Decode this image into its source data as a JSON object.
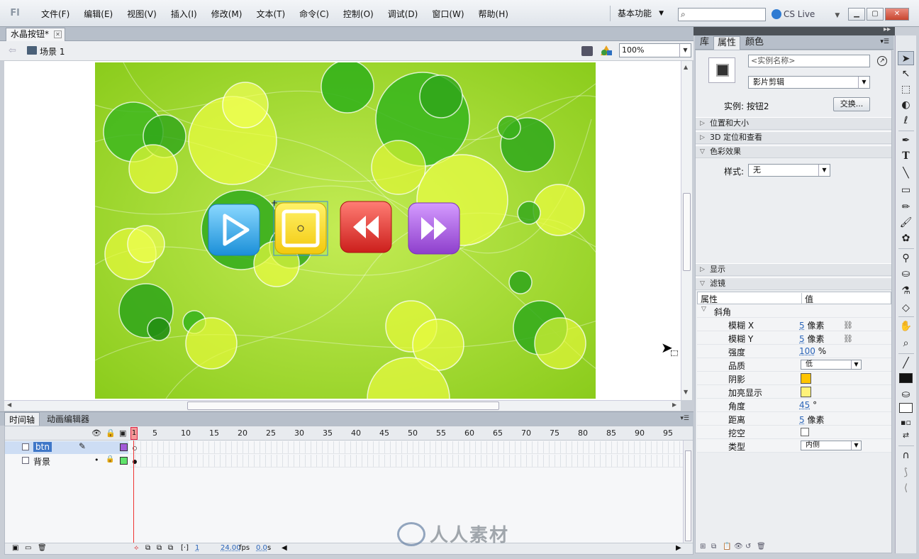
{
  "menu": {
    "app_logo": "Fl",
    "items": [
      "文件(F)",
      "编辑(E)",
      "视图(V)",
      "插入(I)",
      "修改(M)",
      "文本(T)",
      "命令(C)",
      "控制(O)",
      "调试(D)",
      "窗口(W)",
      "帮助(H)"
    ],
    "workspace": "基本功能",
    "search_icon": "search-icon",
    "cs_live": "CS Live"
  },
  "document": {
    "tab_title": "水晶按钮*",
    "scene": "场景 1",
    "zoom": "100%"
  },
  "stage": {
    "background_color": "#9ed22c",
    "buttons": [
      {
        "name": "play-button",
        "color": "#3aa9e8",
        "icon": "play-icon"
      },
      {
        "name": "stop-button",
        "color": "#f7dc1f",
        "icon": "stop-icon"
      },
      {
        "name": "rewind-button",
        "color": "#e23b35",
        "icon": "rewind-icon"
      },
      {
        "name": "fast-forward-button",
        "color": "#a35ad8",
        "icon": "fast-forward-icon"
      }
    ]
  },
  "timeline": {
    "tabs": [
      "时间轴",
      "动画编辑器"
    ],
    "frame_numbers": [
      "1",
      "5",
      "10",
      "15",
      "20",
      "25",
      "30",
      "35",
      "40",
      "45",
      "50",
      "55",
      "60",
      "65",
      "70",
      "75",
      "80",
      "85",
      "90",
      "95"
    ],
    "layers": [
      {
        "name": "btn",
        "selected": true,
        "color": "#a35ad8"
      },
      {
        "name": "背景",
        "selected": false,
        "color": "#5fe36b"
      }
    ],
    "current_frame": "1",
    "fps": "24.00",
    "fps_unit": "fps",
    "seconds": "0.0",
    "seconds_unit": "s"
  },
  "panel": {
    "tabs": [
      "库",
      "属性",
      "颜色"
    ],
    "instance_name_placeholder": "<实例名称>",
    "symbol_type": "影片剪辑",
    "instance_label": "实例: 按钮2",
    "swap_button": "交换...",
    "sections": {
      "position": "位置和大小",
      "three_d": "3D 定位和查看",
      "color_effect": "色彩效果",
      "display": "显示",
      "filters": "滤镜"
    },
    "style_label": "样式:",
    "style_value": "无",
    "filter_table": {
      "col_property": "属性",
      "col_value": "值",
      "group": "斜角",
      "rows": [
        {
          "label": "模糊 X",
          "value": "5",
          "unit": "像素",
          "linked": true
        },
        {
          "label": "模糊 Y",
          "value": "5",
          "unit": "像素",
          "linked": true
        },
        {
          "label": "强度",
          "value": "100",
          "unit": "%"
        },
        {
          "label": "品质",
          "dropdown": "低"
        },
        {
          "label": "阴影",
          "swatch": "#ffc400"
        },
        {
          "label": "加亮显示",
          "swatch": "#fff27a"
        },
        {
          "label": "角度",
          "value": "45",
          "unit": "°"
        },
        {
          "label": "距离",
          "value": "5",
          "unit": "像素"
        },
        {
          "label": "挖空",
          "checkbox": false
        },
        {
          "label": "类型",
          "dropdown": "内侧"
        }
      ]
    }
  },
  "watermark": "人人素材"
}
